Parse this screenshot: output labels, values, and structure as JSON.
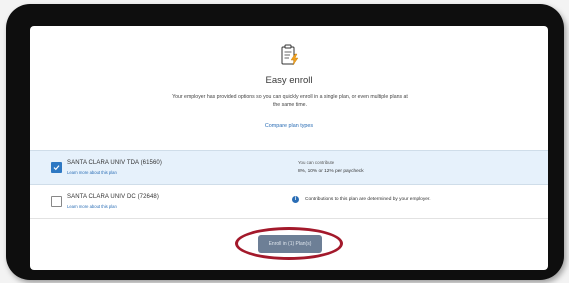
{
  "header": {
    "icon": "clipboard-lightning-icon",
    "title": "Easy enroll",
    "description": "Your employer has provided options so you can quickly enroll in a single plan, or even multiple plans at the same time.",
    "compare_link": "Compare plan types"
  },
  "plans": [
    {
      "name": "SANTA CLARA UNIV TDA (61560)",
      "link": "Learn more about this plan",
      "checked": true,
      "contribution_label": "You can contribute",
      "contribution_value": "8%, 10% or 12% per paycheck"
    },
    {
      "name": "SANTA CLARA UNIV DC (72648)",
      "link": "Learn more about this plan",
      "checked": false,
      "info": "Contributions to this plan are determined by your employer."
    }
  ],
  "footer": {
    "enroll_button": "Enroll in (1) Plan(s)"
  },
  "colors": {
    "frame": "#0e0e0e",
    "accent": "#2a6db5",
    "selected_row": "#e6f1fb",
    "button": "#6d7f96",
    "highlight_ring": "#a3192b"
  }
}
